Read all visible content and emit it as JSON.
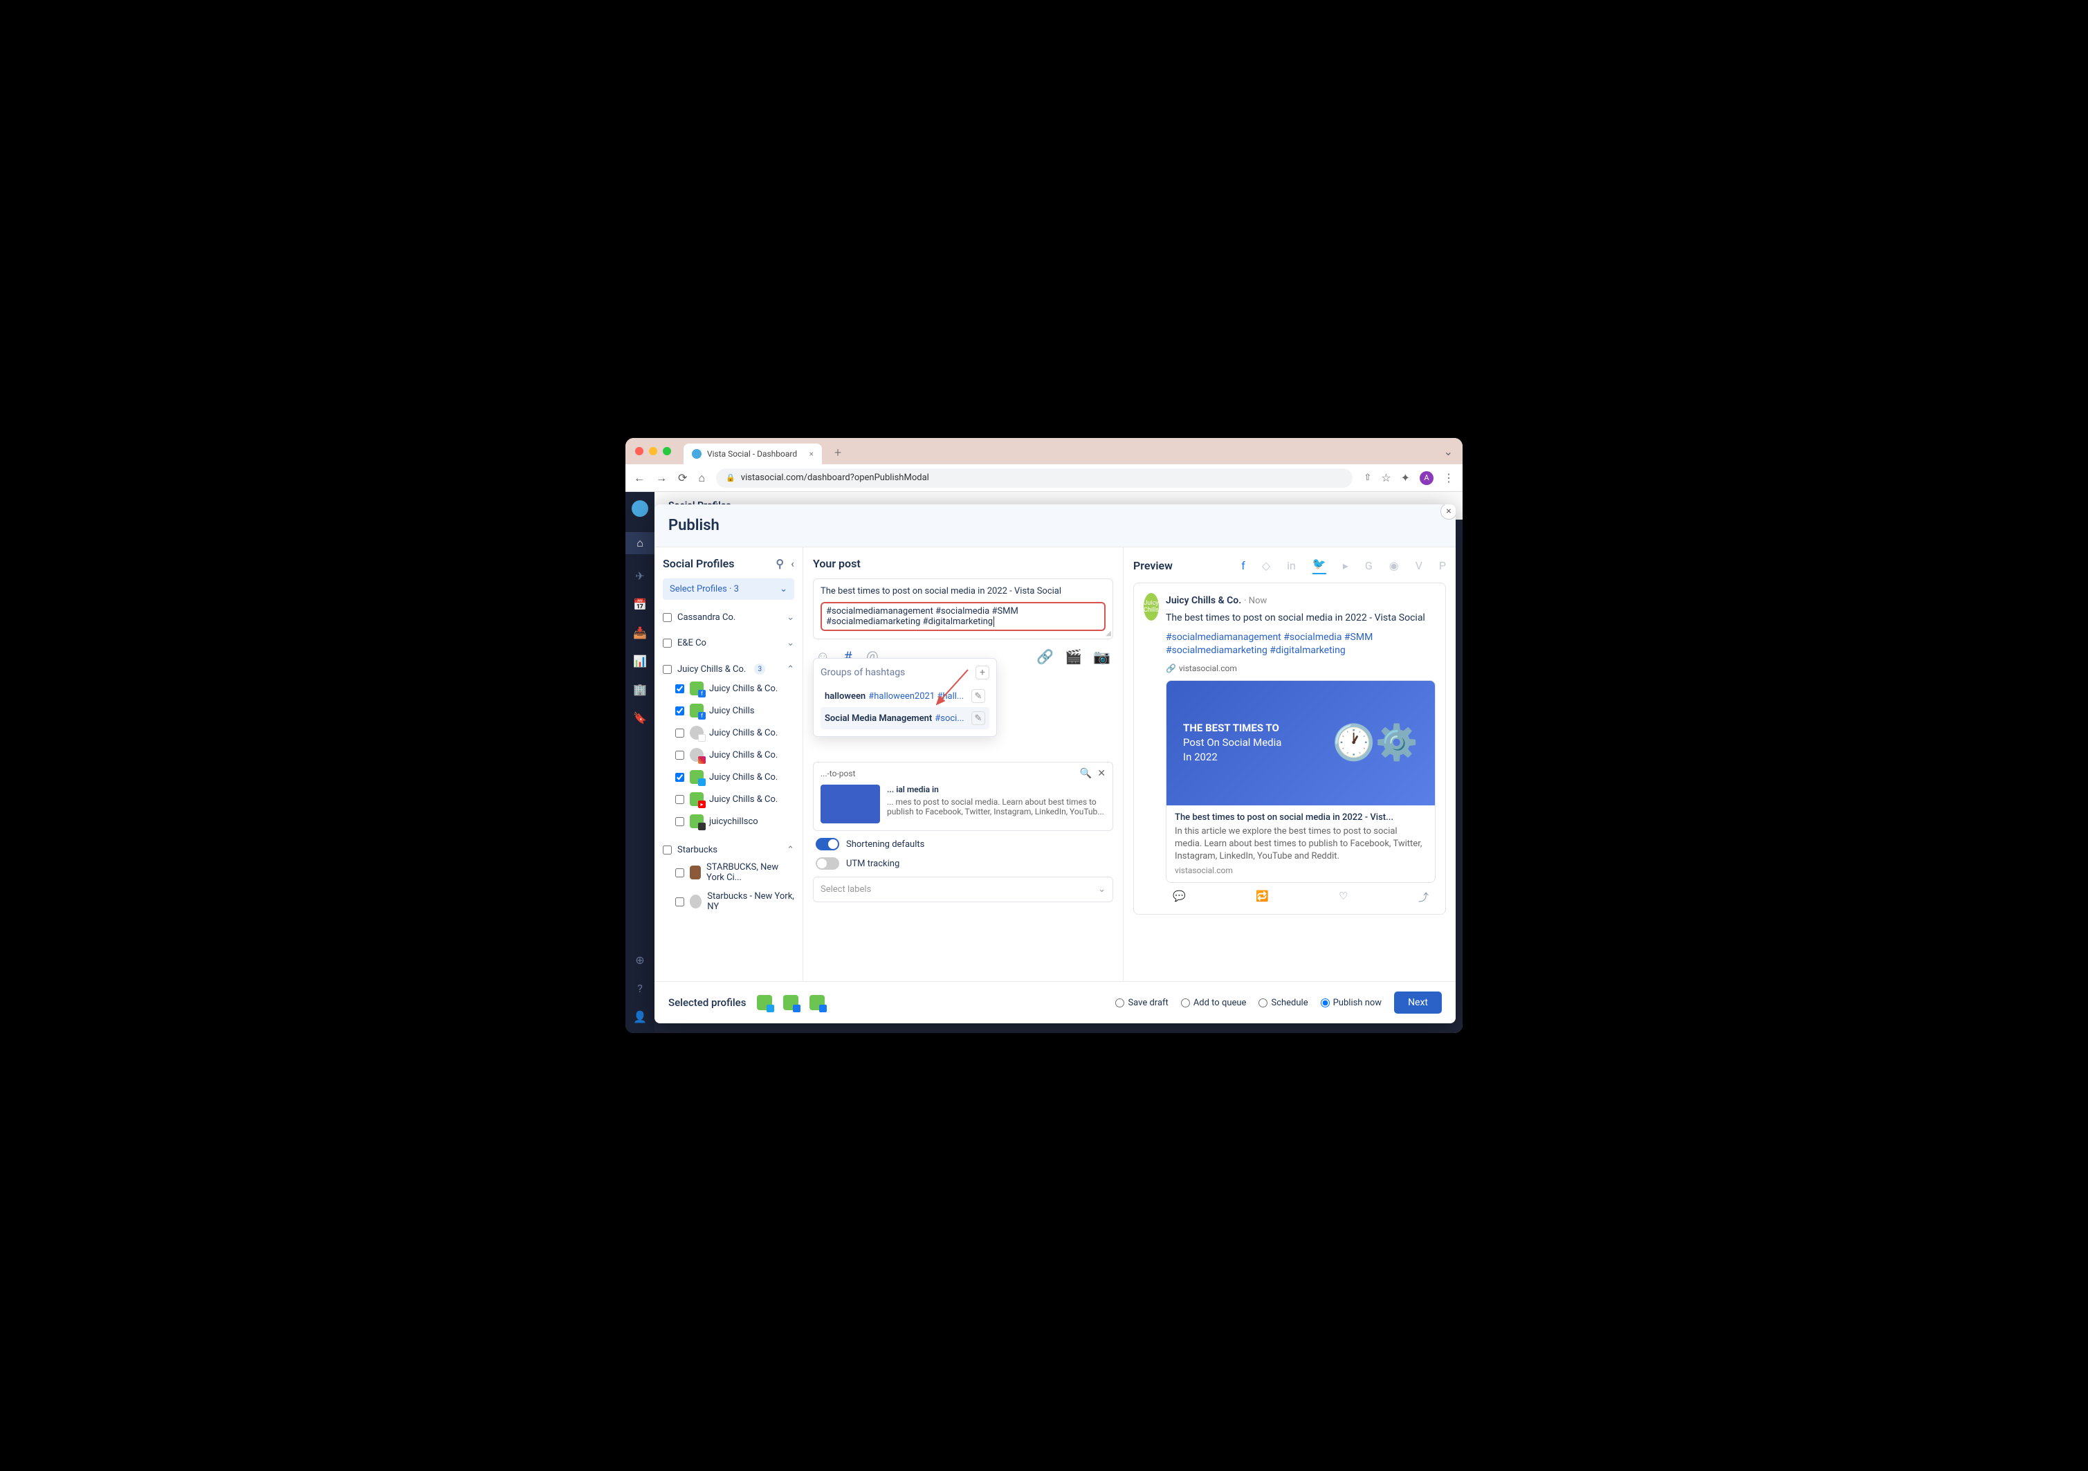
{
  "browser": {
    "tab_title": "Vista Social - Dashboard",
    "url": "vistasocial.com/dashboard?openPublishModal",
    "avatar_letter": "A"
  },
  "sidebar_bg": {
    "title": "Social Profiles"
  },
  "modal": {
    "title": "Publish",
    "profiles": {
      "title": "Social Profiles",
      "select_label": "Select Profiles · 3",
      "groups": [
        {
          "name": "Cassandra Co.",
          "expanded": false
        },
        {
          "name": "E&E Co",
          "expanded": false
        },
        {
          "name": "Juicy Chills & Co.",
          "expanded": true,
          "count": 3,
          "items": [
            {
              "label": "Juicy Chills & Co.",
              "net": "fb",
              "checked": true,
              "pic": "logo"
            },
            {
              "label": "Juicy Chills",
              "net": "fb",
              "checked": true,
              "pic": "logo"
            },
            {
              "label": "Juicy Chills & Co.",
              "net": "gg",
              "checked": false,
              "pic": "person"
            },
            {
              "label": "Juicy Chills & Co.",
              "net": "ig",
              "checked": false,
              "pic": "person"
            },
            {
              "label": "Juicy Chills & Co.",
              "net": "tw",
              "checked": true,
              "pic": "logo"
            },
            {
              "label": "Juicy Chills & Co.",
              "net": "yt",
              "checked": false,
              "pic": "logo"
            },
            {
              "label": "juicychillsco",
              "net": "blk",
              "checked": false,
              "pic": "logo"
            }
          ]
        },
        {
          "name": "Starbucks",
          "expanded": true,
          "items": [
            {
              "label": "STARBUCKS, New York Ci...",
              "net": "",
              "checked": false,
              "pic": "photo"
            },
            {
              "label": "Starbucks - New York, NY",
              "net": "",
              "checked": false,
              "pic": "person"
            }
          ]
        }
      ]
    },
    "compose": {
      "title": "Your post",
      "text": "The best times to post on social media in 2022 - Vista Social",
      "hashtags": "#socialmediamanagement #socialmedia #SMM #socialmediamarketing #digitalmarketing",
      "popover": {
        "title": "Groups of hashtags",
        "items": [
          {
            "name": "halloween",
            "tags": "#halloween2021 #hall..."
          },
          {
            "name": "Social Media Management",
            "tags": "#soci..."
          }
        ]
      },
      "link_preview": {
        "url_frag": "...-to-post",
        "title": "... ial media in",
        "desc": "... mes to post to social media. Learn about best times to publish to Facebook, Twitter, Instagram, LinkedIn, YouTub..."
      },
      "shortening_label": "Shortening defaults",
      "utm_label": "UTM tracking",
      "labels_placeholder": "Select labels"
    },
    "preview": {
      "title": "Preview",
      "account": "Juicy Chills & Co.",
      "time": "Now",
      "text": "The best times to post on social media in 2022 - Vista Social",
      "hashtags_l1": "#socialmediamanagement #socialmedia #SMM",
      "hashtags_l2": "#socialmediamarketing #digitalmarketing",
      "domain": "vistasocial.com",
      "card": {
        "img_line1": "THE BEST TIMES TO",
        "img_line2": "Post On Social Media",
        "img_line3": "In 2022",
        "title": "The best times to post on social media in 2022 - Vist...",
        "desc": "In this article we explore the best times to post to social media. Learn about best times to publish to Facebook, Twitter, Instagram, LinkedIn, YouTube and Reddit.",
        "source": "vistasocial.com"
      }
    },
    "footer": {
      "label": "Selected profiles",
      "options": [
        "Save draft",
        "Add to queue",
        "Schedule",
        "Publish now"
      ],
      "selected": "Publish now",
      "next": "Next"
    }
  }
}
